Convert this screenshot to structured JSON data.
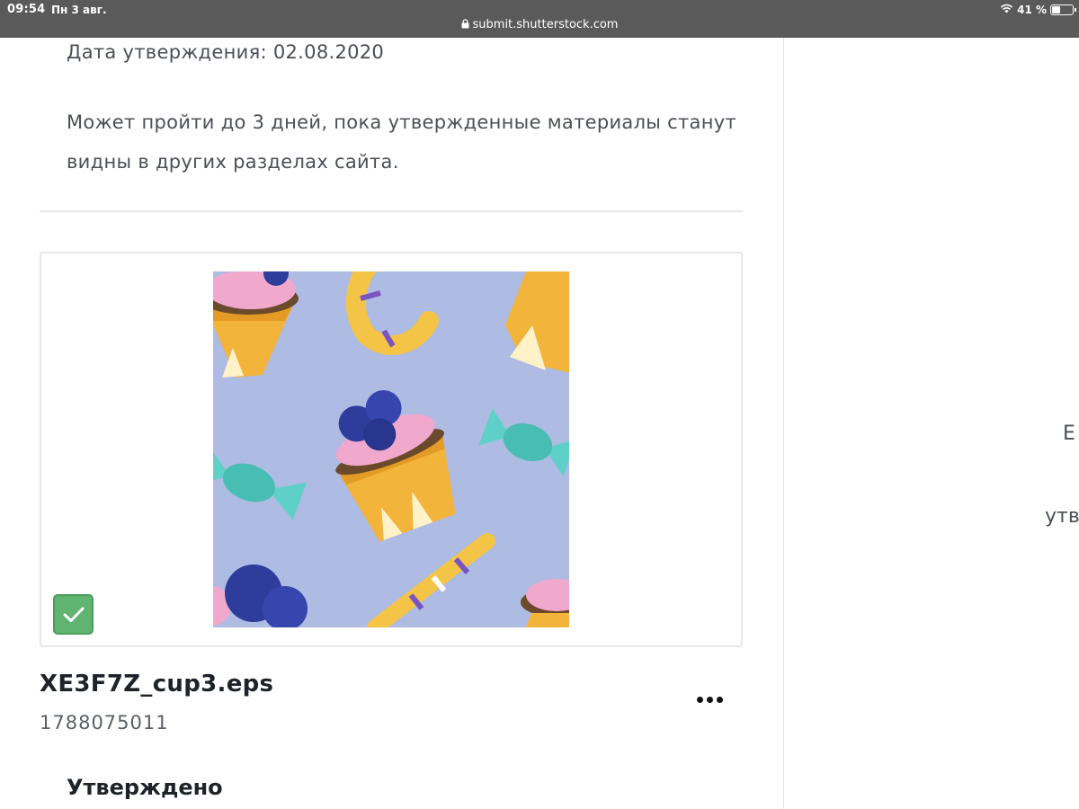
{
  "status_bar": {
    "time": "09:54",
    "date": "Пн 3 авг.",
    "url": "submit.shutterstock.com",
    "battery_text": "41 %",
    "battery_level": 0.41,
    "icons": [
      "lock-icon",
      "wifi-icon",
      "battery-icon"
    ]
  },
  "page": {
    "approval_date": "Дата утверждения: 02.08.2020",
    "info": "Может пройти до 3 дней, пока утвержденные материалы станут видны в других разделах сайта."
  },
  "asset": {
    "filename": "XE3F7Z_cup3.eps",
    "id": "1788075011",
    "status": "Утверждено",
    "selected_icon": "checkmark-icon",
    "more_icon": "more-dots-icon"
  },
  "right_panel": {
    "fragment_1": "Е",
    "fragment_2": "утв"
  },
  "colors": {
    "status_bar_bg": "#5a5a5a",
    "thumbnail_bg": "#aebbe2",
    "badge_green": "#5fb46f",
    "text_dark": "#1f2329",
    "text_muted": "#4b4f56"
  }
}
